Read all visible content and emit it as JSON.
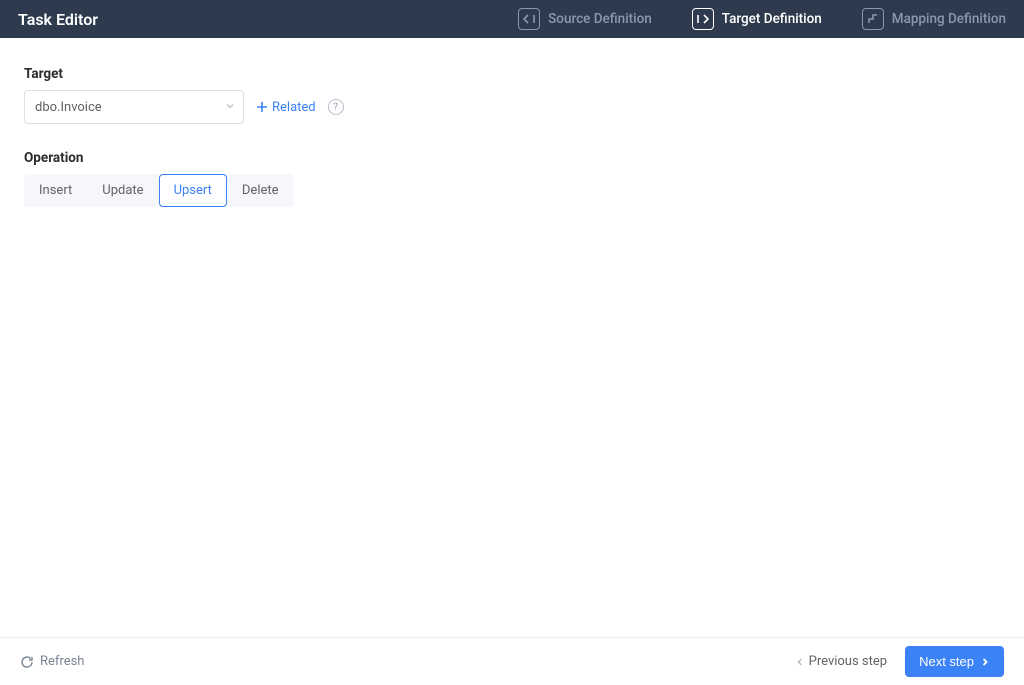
{
  "header": {
    "title": "Task Editor",
    "steps": {
      "source": "Source Definition",
      "target": "Target Definition",
      "mapping": "Mapping Definition"
    }
  },
  "target": {
    "label": "Target",
    "selected_value": "dbo.Invoice",
    "related_label": "Related"
  },
  "operation": {
    "label": "Operation",
    "options": {
      "insert": "Insert",
      "update": "Update",
      "upsert": "Upsert",
      "delete": "Delete"
    },
    "selected": "upsert"
  },
  "footer": {
    "refresh": "Refresh",
    "prev": "Previous step",
    "next": "Next step"
  }
}
